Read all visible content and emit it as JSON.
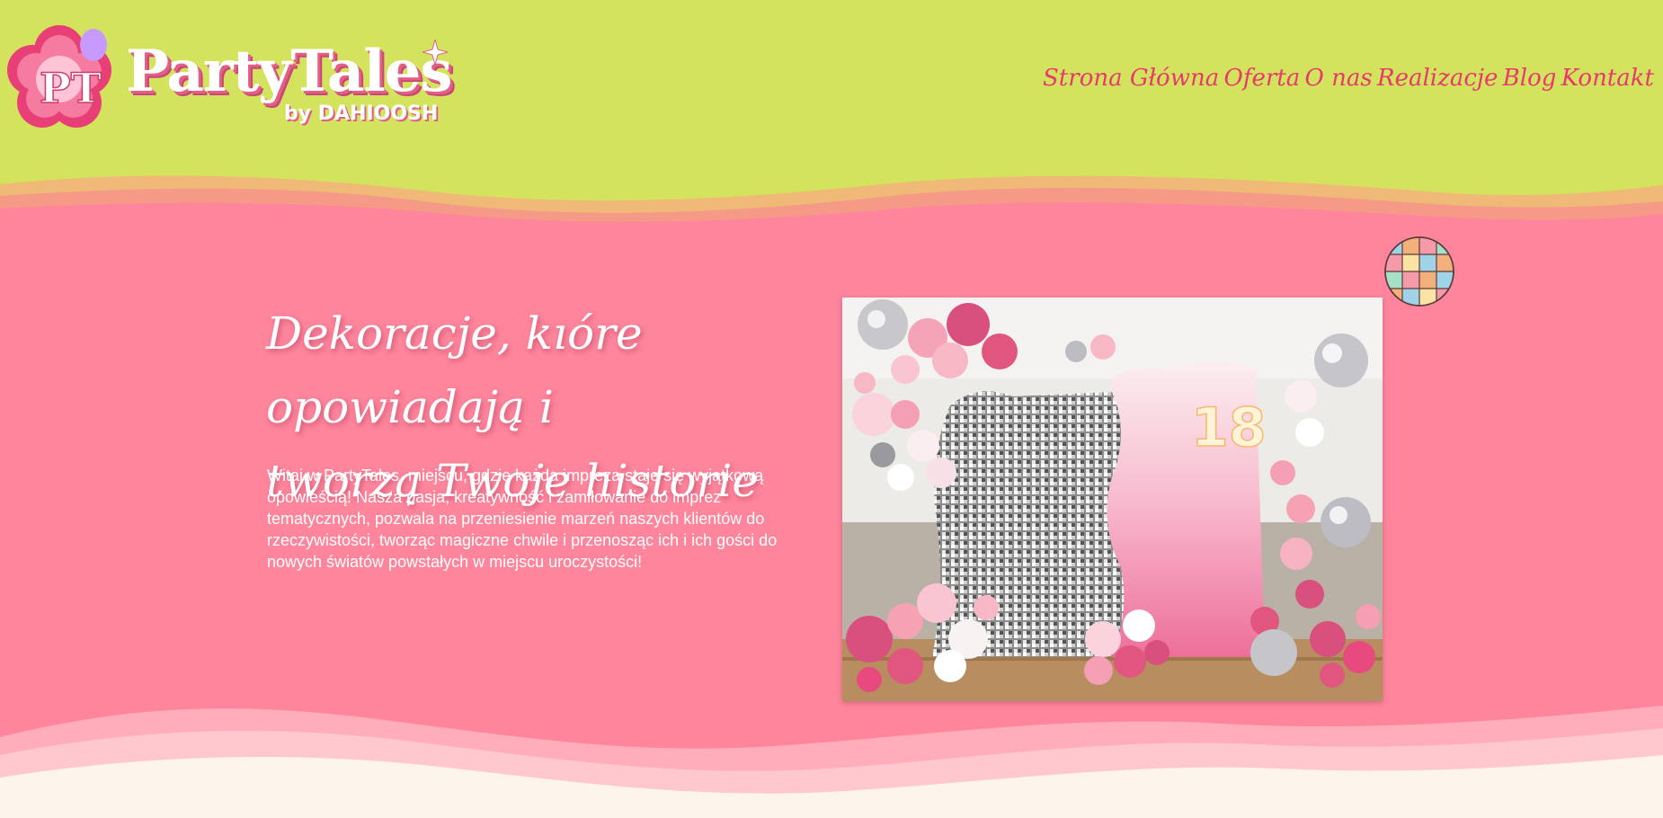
{
  "brand": {
    "initials": "PT",
    "name": "PartyTales",
    "tagline": "by DAHIOOSH"
  },
  "nav": {
    "items": [
      {
        "label": "Strona Główna"
      },
      {
        "label": "Oferta"
      },
      {
        "label": "O nas"
      },
      {
        "label": "Realizacje"
      },
      {
        "label": "Blog"
      },
      {
        "label": "Kontakt"
      }
    ]
  },
  "hero": {
    "title_line1": "Dekoracje, kıóre opowiadają i",
    "title_line2": "tworzą Twoje historie",
    "description": "Witaj w PartyTales, miejscu, gdzie każda impreza staje się wyjątkową opowieścią! Nasza pasja, kreatywność i zamiłowanie do imprez tematycznych, pozwala na przeniesienie marzeń naszych klientów do rzeczywistości, tworząc magiczne chwile i przenosząc ich i ich gości do nowych światów powstałych w miejscu uroczystości!",
    "photo_number": "18"
  },
  "colors": {
    "header_bg": "#d4e35d",
    "hero_bg": "#ff859c",
    "nav_text": "#e8396c",
    "footer_cream": "#fdf4ec"
  }
}
